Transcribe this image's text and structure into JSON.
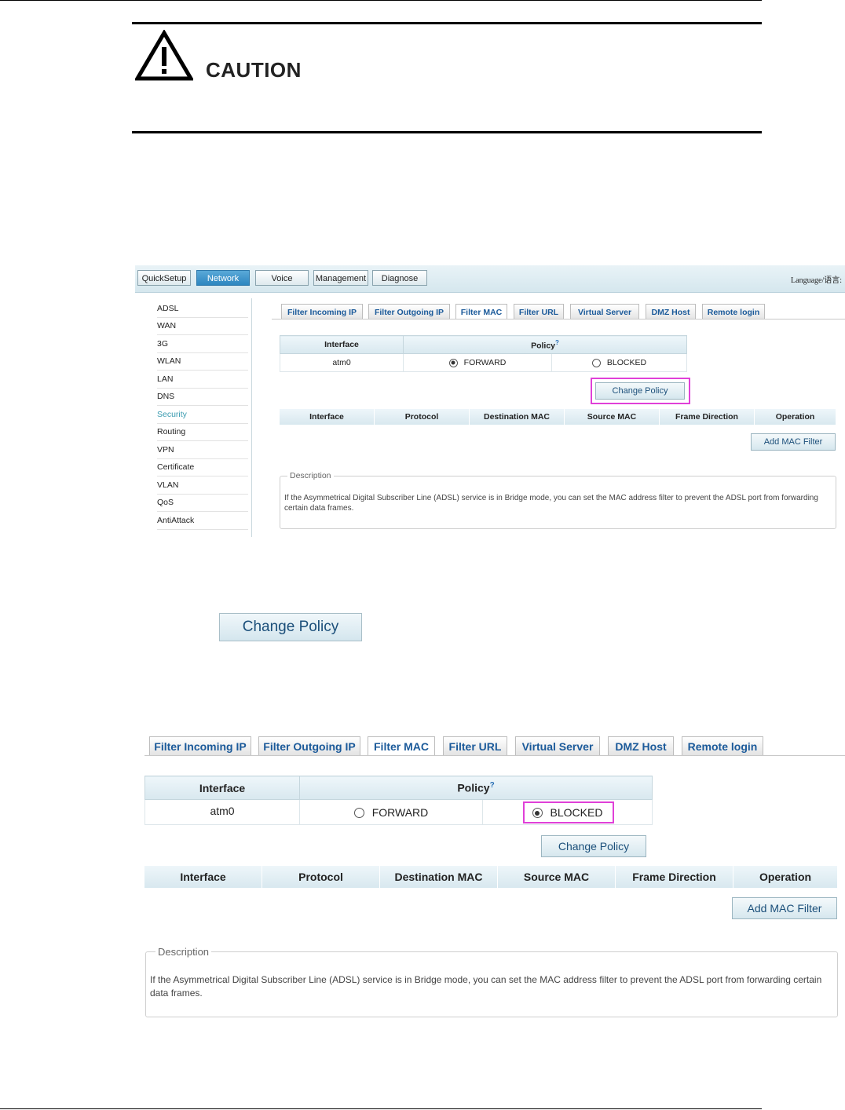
{
  "caution": {
    "title": "CAUTION"
  },
  "screenshot1": {
    "nav": [
      "QuickSetup",
      "Network",
      "Voice",
      "Management",
      "Diagnose"
    ],
    "nav_active": "Network",
    "language_label": "Language/语言:",
    "sidebar": [
      "ADSL",
      "WAN",
      "3G",
      "WLAN",
      "LAN",
      "DNS",
      "Security",
      "Routing",
      "VPN",
      "Certificate",
      "VLAN",
      "QoS",
      "AntiAttack"
    ],
    "sidebar_active": "Security",
    "tabs": [
      "Filter Incoming IP",
      "Filter Outgoing IP",
      "Filter MAC",
      "Filter URL",
      "Virtual Server",
      "DMZ Host",
      "Remote login"
    ],
    "tab_active": "Filter MAC",
    "policy_table": {
      "col_interface": "Interface",
      "col_policy": "Policy",
      "policy_help": "?",
      "interface": "atm0",
      "forward": "FORWARD",
      "blocked": "BLOCKED",
      "selected": "FORWARD"
    },
    "change_policy": "Change Policy",
    "filter_columns": [
      "Interface",
      "Protocol",
      "Destination MAC",
      "Source MAC",
      "Frame Direction",
      "Operation"
    ],
    "add_mac_filter": "Add MAC Filter",
    "description_legend": "Description",
    "description_text": "If the Asymmetrical Digital Subscriber Line (ADSL) service is in Bridge mode, you can set the MAC address filter to prevent the ADSL port from forwarding certain data frames."
  },
  "standalone_button": "Change Policy",
  "screenshot2": {
    "tabs": [
      "Filter Incoming IP",
      "Filter Outgoing IP",
      "Filter MAC",
      "Filter URL",
      "Virtual Server",
      "DMZ Host",
      "Remote login"
    ],
    "tab_active": "Filter MAC",
    "policy_table": {
      "col_interface": "Interface",
      "col_policy": "Policy",
      "policy_help": "?",
      "interface": "atm0",
      "forward": "FORWARD",
      "blocked": "BLOCKED",
      "selected": "BLOCKED"
    },
    "change_policy": "Change Policy",
    "filter_columns": [
      "Interface",
      "Protocol",
      "Destination MAC",
      "Source MAC",
      "Frame Direction",
      "Operation"
    ],
    "add_mac_filter": "Add MAC Filter",
    "description_legend": "Description",
    "description_text": "If the Asymmetrical Digital Subscriber Line (ADSL) service is in Bridge mode, you can set the MAC address filter to prevent the ADSL port from forwarding certain data frames."
  },
  "colors": {
    "highlight": "#e040d8",
    "nav_active": "#2d86c0",
    "tab_text": "#1b5a9a"
  }
}
